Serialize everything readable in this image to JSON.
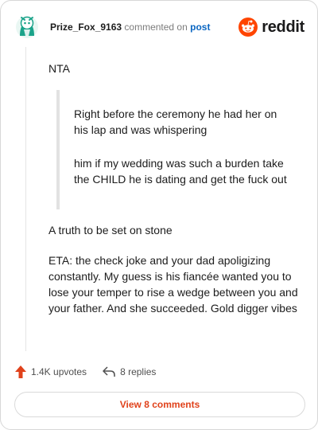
{
  "header": {
    "username": "Prize_Fox_9163",
    "action": "commented on",
    "post_link": "post",
    "brand": "reddit"
  },
  "comment": {
    "verdict": "NTA",
    "quote": [
      "Right before the ceremony he had her on his lap and was whispering",
      "him if my wedding was such a burden take the CHILD he is dating and get the fuck out"
    ],
    "paragraphs": [
      "A truth to be set on stone",
      "ETA: the check joke and your dad apoligizing constantly. My guess is his fiancée wanted you to lose your temper to rise a wedge between you and your father. And she succeeded. Gold digger vibes"
    ]
  },
  "footer": {
    "upvotes": "1.4K upvotes",
    "replies": "8 replies",
    "view_button": "View 8 comments"
  },
  "colors": {
    "reddit_orange": "#ff4500",
    "upvote": "#e0421b",
    "link_blue": "#0a66c2",
    "avatar_teal": "#1aa38a"
  },
  "icons": {
    "avatar": "snoo-avatar-icon",
    "logo": "reddit-logo-icon",
    "upvote": "upvote-arrow-icon",
    "reply": "reply-arrow-icon"
  }
}
